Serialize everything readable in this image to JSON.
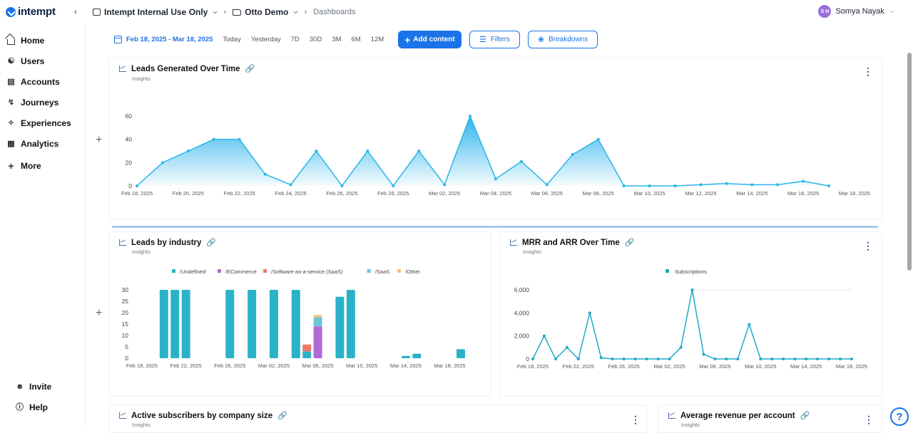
{
  "brand": {
    "logo_text": "intempt"
  },
  "breadcrumb": {
    "project": "Intempt Internal Use Only",
    "workspace": "Otto Demo",
    "page": "Dashboards"
  },
  "user": {
    "initials": "S N",
    "name": "Somya Nayak",
    "avatar_color": "#9a6fdd"
  },
  "sidebar": {
    "items": [
      {
        "label": "Home",
        "icon": "home-icon"
      },
      {
        "label": "Users",
        "icon": "users-icon"
      },
      {
        "label": "Accounts",
        "icon": "accounts-icon"
      },
      {
        "label": "Journeys",
        "icon": "journeys-icon"
      },
      {
        "label": "Experiences",
        "icon": "experiences-icon"
      },
      {
        "label": "Analytics",
        "icon": "analytics-icon"
      },
      {
        "label": "More",
        "icon": "plus-icon"
      }
    ],
    "footer": [
      {
        "label": "Invite",
        "icon": "invite-icon"
      },
      {
        "label": "Help",
        "icon": "help-icon"
      }
    ]
  },
  "toolbar": {
    "date_range": "Feb 18, 2025 - Mar 18, 2025",
    "presets": [
      "Today",
      "Yesterday",
      "7D",
      "30D",
      "3M",
      "6M",
      "12M"
    ],
    "add_content": "Add content",
    "filters": "Filters",
    "breakdowns": "Breakdowns"
  },
  "colors": {
    "accent": "#1a73e8",
    "area": "#29b6e8"
  },
  "cards": {
    "leads_over_time": {
      "title": "Leads Generated Over Time",
      "subtitle": "Insights"
    },
    "leads_by_industry": {
      "title": "Leads by industry",
      "subtitle": "Insights"
    },
    "mrr_arr": {
      "title": "MRR and ARR Over Time",
      "subtitle": "Insights"
    },
    "active_subscribers": {
      "title": "Active subscribers by company size",
      "subtitle": "Insights"
    },
    "avg_revenue": {
      "title": "Average revenue per account",
      "subtitle": "Insights"
    }
  },
  "chart_data": [
    {
      "type": "area",
      "title": "Leads Generated Over Time",
      "x": [
        "Feb 18, 2025",
        "Feb 19, 2025",
        "Feb 20, 2025",
        "Feb 21, 2025",
        "Feb 22, 2025",
        "Feb 23, 2025",
        "Feb 24, 2025",
        "Feb 25, 2025",
        "Feb 26, 2025",
        "Feb 27, 2025",
        "Feb 28, 2025",
        "Mar 01, 2025",
        "Mar 02, 2025",
        "Mar 03, 2025",
        "Mar 04, 2025",
        "Mar 05, 2025",
        "Mar 06, 2025",
        "Mar 07, 2025",
        "Mar 08, 2025",
        "Mar 09, 2025",
        "Mar 10, 2025",
        "Mar 11, 2025",
        "Mar 12, 2025",
        "Mar 13, 2025",
        "Mar 14, 2025",
        "Mar 15, 2025",
        "Mar 16, 2025",
        "Mar 17, 2025",
        "Mar 18, 2025"
      ],
      "xticks": [
        "Feb 18, 2025",
        "Feb 20, 2025",
        "Feb 22, 2025",
        "Feb 24, 2025",
        "Feb 26, 2025",
        "Feb 28, 2025",
        "Mar 02, 2025",
        "Mar 04, 2025",
        "Mar 06, 2025",
        "Mar 08, 2025",
        "Mar 10, 2025",
        "Mar 12, 2025",
        "Mar 14, 2025",
        "Mar 16, 2025",
        "Mar 18, 2025"
      ],
      "series": [
        {
          "values": [
            0,
            20,
            30,
            40,
            40,
            10,
            1,
            30,
            0,
            30,
            0,
            30,
            1,
            60,
            6,
            21,
            1,
            27,
            40,
            0,
            0,
            0,
            1,
            2,
            1,
            1,
            4,
            0
          ]
        }
      ],
      "ylim": [
        0,
        60
      ],
      "yticks": [
        0,
        20,
        40,
        60
      ],
      "grid": false
    },
    {
      "type": "bar",
      "title": "Leads by industry",
      "legend": [
        "/Undefined",
        "/ECommerce",
        "/Software-as-a-service (SaaS)",
        "/SaaS",
        "/Other"
      ],
      "legend_colors": [
        "#2ab3c8",
        "#b06ad6",
        "#f0776e",
        "#6cc3d6",
        "#f4c27b"
      ],
      "xticks": [
        "Feb 18, 2025",
        "Feb 22, 2025",
        "Feb 26, 2025",
        "Mar 02, 2025",
        "Mar 06, 2025",
        "Mar 10, 2025",
        "Mar 14, 2025",
        "Mar 18, 2025"
      ],
      "bars": [
        {
          "x": 2,
          "stack": [
            30,
            0,
            0,
            0,
            0
          ]
        },
        {
          "x": 3,
          "stack": [
            30,
            0,
            0,
            0,
            0
          ]
        },
        {
          "x": 4,
          "stack": [
            30,
            0,
            0,
            0,
            0
          ]
        },
        {
          "x": 8,
          "stack": [
            30,
            0,
            0,
            0,
            0
          ]
        },
        {
          "x": 10,
          "stack": [
            30,
            0,
            0,
            0,
            0
          ]
        },
        {
          "x": 12,
          "stack": [
            30,
            0,
            0,
            0,
            0
          ]
        },
        {
          "x": 14,
          "stack": [
            30,
            0,
            0,
            0,
            0
          ]
        },
        {
          "x": 15,
          "stack": [
            3,
            0,
            3,
            0,
            0
          ]
        },
        {
          "x": 16,
          "stack": [
            0,
            14,
            0,
            4,
            1
          ]
        },
        {
          "x": 18,
          "stack": [
            27,
            0,
            0,
            0,
            0
          ]
        },
        {
          "x": 19,
          "stack": [
            30,
            0,
            0,
            0,
            0
          ]
        },
        {
          "x": 24,
          "stack": [
            1,
            0,
            0,
            0,
            0
          ]
        },
        {
          "x": 25,
          "stack": [
            2,
            0,
            0,
            0,
            0
          ]
        },
        {
          "x": 29,
          "stack": [
            4,
            0,
            0,
            0,
            0
          ]
        }
      ],
      "yticks": [
        0,
        5,
        10,
        15,
        20,
        25,
        30
      ],
      "ylim": [
        0,
        30
      ]
    },
    {
      "type": "line",
      "title": "MRR and ARR Over Time",
      "legend": [
        "Subscriptions"
      ],
      "xticks": [
        "Feb 18, 2025",
        "Feb 22, 2025",
        "Feb 26, 2025",
        "Mar 02, 2025",
        "Mar 06, 2025",
        "Mar 10, 2025",
        "Mar 14, 2025",
        "Mar 18, 2025"
      ],
      "series": [
        {
          "name": "Subscriptions",
          "values": [
            0,
            2000,
            0,
            1000,
            0,
            4000,
            100,
            0,
            0,
            0,
            0,
            0,
            0,
            1000,
            6000,
            400,
            0,
            0,
            0,
            3000,
            0,
            0,
            0,
            0,
            0,
            0,
            0,
            0,
            0
          ]
        }
      ],
      "yticks": [
        "0",
        "2,000",
        "4,000",
        "6,000"
      ],
      "ylim": [
        0,
        6000
      ]
    }
  ]
}
